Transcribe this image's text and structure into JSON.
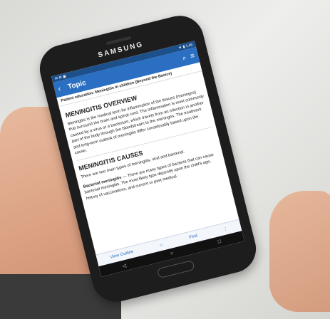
{
  "device": {
    "brand": "SAMSUNG"
  },
  "statusbar": {
    "left": "✉ ⚙ ▣",
    "right": "▼ ▮ 1:46"
  },
  "appbar": {
    "back_icon": "‹",
    "title": "Topic",
    "search_icon": "⌕",
    "menu_icon": "≡"
  },
  "breadcrumb": "Patient education: Meningitis in children (Beyond the Basics)",
  "overview": {
    "heading": "MENINGITIS OVERVIEW",
    "body": "Meningitis is the medical term for inflammation of the tissues (meninges) that surround the brain and spinal cord. The inflammation is most commonly caused by a virus or a bacterium, which travels from an infection in another part of the body through the bloodstream to the meninges. The treatment and long-term outlook of meningitis differ considerably based upon the cause."
  },
  "causes": {
    "heading": "MENINGITIS CAUSES",
    "intro": "There are two main types of meningitis: viral and bacterial.",
    "bacterial_label": "Bacterial meningitis",
    "bacterial_body": " — There are many types of bacteria that can cause bacterial meningitis. The most likely type depends upon the child's age, history of vaccinations, and current or past medical"
  },
  "bottombar": {
    "view_outline": "View Outline",
    "star_icon": "☆",
    "find": "Find",
    "more_icon": "⋮"
  },
  "navbar": {
    "back": "◁",
    "home": "○",
    "recents": "□"
  }
}
